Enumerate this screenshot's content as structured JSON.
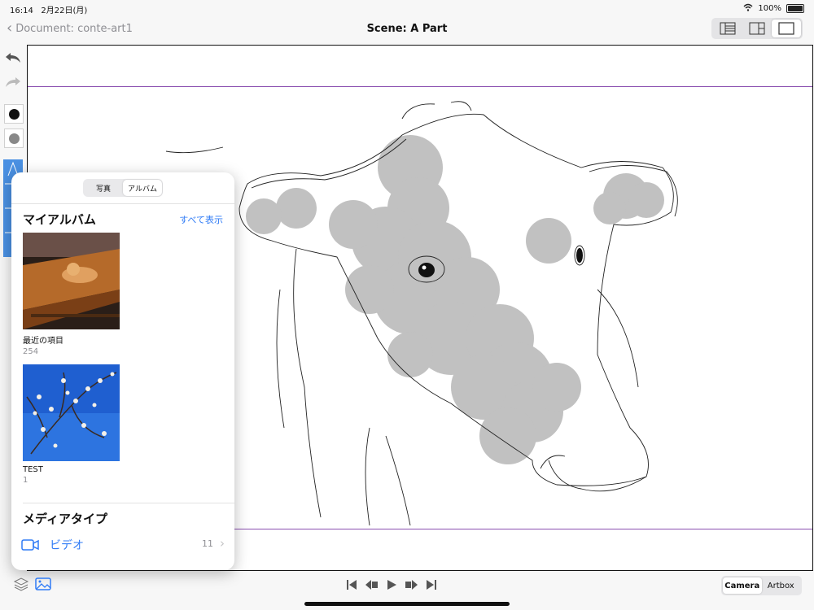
{
  "status": {
    "time": "16:14",
    "date": "2月22日(月)",
    "battery": "100%"
  },
  "nav": {
    "back_label": "Document: conte-art1",
    "title": "Scene: A Part"
  },
  "view_modes": [
    "list-view-icon",
    "split-view-icon",
    "single-view-icon"
  ],
  "tools": {
    "colors": [
      "#111111",
      "#888888"
    ]
  },
  "picker": {
    "segments": [
      "写真",
      "アルバム"
    ],
    "active_segment": "アルバム",
    "my_albums_title": "マイアルバム",
    "see_all": "すべて表示",
    "albums": [
      {
        "name": "最近の項目",
        "count": "254"
      },
      {
        "name": "TEST",
        "count": "1"
      }
    ],
    "media_types_title": "メディアタイプ",
    "media_types": [
      {
        "name": "ビデオ",
        "count": "11",
        "icon": "video-icon"
      }
    ]
  },
  "bottom": {
    "camera_label": "Camera",
    "artbox_label": "Artbox",
    "active": "Camera"
  },
  "colors": {
    "accent": "#2f7bf6",
    "guide": "#8a4fb0",
    "brush_panel": "#4a90e2"
  }
}
